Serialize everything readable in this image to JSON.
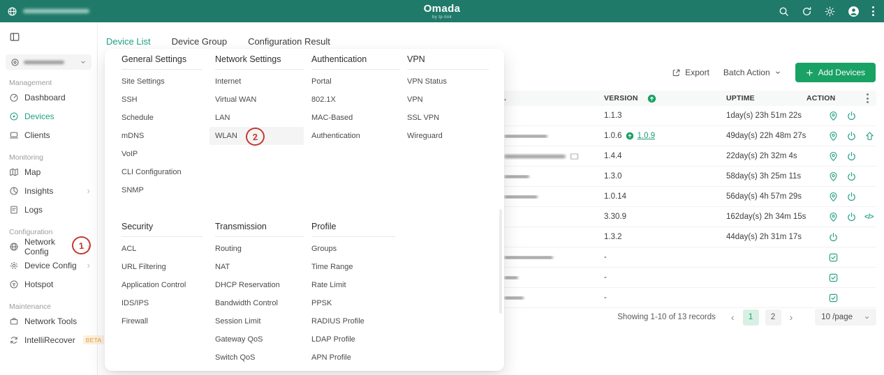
{
  "topbar": {
    "brand": "Omada",
    "brand_subtitle": "by tp-link"
  },
  "sidebar": {
    "sections": [
      {
        "label": "Management",
        "items": [
          {
            "label": "Dashboard"
          },
          {
            "label": "Devices"
          },
          {
            "label": "Clients"
          }
        ]
      },
      {
        "label": "Monitoring",
        "items": [
          {
            "label": "Map"
          },
          {
            "label": "Insights"
          },
          {
            "label": "Logs"
          }
        ]
      },
      {
        "label": "Configuration",
        "items": [
          {
            "label": "Network Config"
          },
          {
            "label": "Device Config"
          },
          {
            "label": "Hotspot"
          }
        ]
      },
      {
        "label": "Maintenance",
        "items": [
          {
            "label": "Network Tools"
          },
          {
            "label": "IntelliRecover",
            "badge": "BETA"
          }
        ]
      }
    ]
  },
  "tabs": [
    {
      "label": "Device List"
    },
    {
      "label": "Device Group"
    },
    {
      "label": "Configuration Result"
    }
  ],
  "toolbar": {
    "export_label": "Export",
    "batch_action_label": "Batch Action",
    "add_devices_label": "Add Devices"
  },
  "megamenu": {
    "highlighted_item": "WLAN",
    "groups": [
      {
        "title": "General Settings",
        "items": [
          "Site Settings",
          "SSH",
          "Schedule",
          "mDNS",
          "VoIP",
          "CLI Configuration",
          "SNMP"
        ]
      },
      {
        "title": "Network Settings",
        "items": [
          "Internet",
          "Virtual WAN",
          "LAN",
          "WLAN"
        ]
      },
      {
        "title": "Authentication",
        "items": [
          "Portal",
          "802.1X",
          "MAC-Based Authentication"
        ]
      },
      {
        "title": "VPN",
        "items": [
          "VPN Status",
          "VPN",
          "SSL VPN",
          "Wireguard"
        ]
      },
      {
        "title": "Security",
        "items": [
          "ACL",
          "URL Filtering",
          "Application Control",
          "IDS/IPS",
          "Firewall"
        ]
      },
      {
        "title": "Transmission",
        "items": [
          "Routing",
          "NAT",
          "DHCP Reservation",
          "Bandwidth Control",
          "Session Limit",
          "Gateway QoS",
          "Switch QoS"
        ]
      },
      {
        "title": "Profile",
        "items": [
          "Groups",
          "Time Range",
          "Rate Limit",
          "PPSK",
          "RADIUS Profile",
          "LDAP Profile",
          "APN Profile"
        ]
      }
    ]
  },
  "table": {
    "headers": {
      "hidden_fragment": ".",
      "version": "VERSION",
      "uptime": "UPTIME",
      "action": "ACTION"
    },
    "rows": [
      {
        "version": "1.1.3",
        "uptime": "1day(s) 23h 51m 22s",
        "actions": [
          "locate",
          "power"
        ]
      },
      {
        "version": "1.0.6",
        "upgrade_available": "1.0.9",
        "uptime": "49day(s) 22h 48m 27s",
        "actions": [
          "locate",
          "power",
          "upgrade"
        ]
      },
      {
        "version": "1.4.4",
        "uptime": "22day(s) 2h 32m 4s",
        "actions": [
          "locate",
          "power"
        ]
      },
      {
        "version": "1.3.0",
        "uptime": "58day(s) 3h 25m 11s",
        "actions": [
          "locate",
          "power"
        ]
      },
      {
        "version": "1.0.14",
        "uptime": "56day(s) 4h 57m 29s",
        "actions": [
          "locate",
          "power"
        ]
      },
      {
        "version": "3.30.9",
        "uptime": "162day(s) 2h 34m 15s",
        "actions": [
          "locate",
          "power",
          "code"
        ]
      },
      {
        "version": "1.3.2",
        "uptime": "44day(s) 2h 31m 17s",
        "actions": [
          "power"
        ]
      },
      {
        "version": "-",
        "uptime": "",
        "actions": [
          "adopt"
        ]
      },
      {
        "version": "-",
        "uptime": "",
        "actions": [
          "adopt"
        ]
      },
      {
        "version": "-",
        "uptime": "",
        "actions": [
          "adopt"
        ]
      }
    ]
  },
  "pagination": {
    "summary": "Showing 1-10 of 13 records",
    "pages": [
      "1",
      "2"
    ],
    "active_page": "1",
    "per_page": "10 /page"
  },
  "annotations": [
    {
      "label": "1",
      "target": "Network Config"
    },
    {
      "label": "2",
      "target": "WLAN"
    }
  ],
  "colors": {
    "topbar_bg": "#1f7a69",
    "accent_green": "#1aa164",
    "active_text_green": "#21a184",
    "annotation_red": "#c23a30",
    "beta_badge_text": "#e69b3c",
    "beta_badge_bg": "#fdf1df",
    "pagination_active_bg": "#d8f0e4"
  }
}
